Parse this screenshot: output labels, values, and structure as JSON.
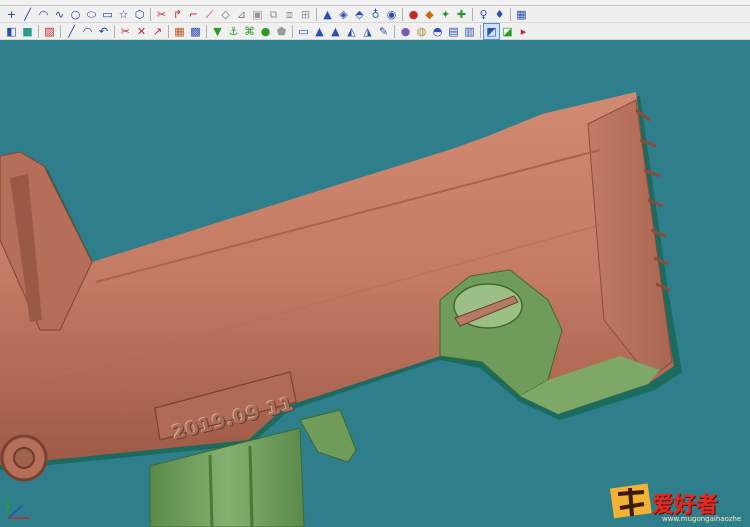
{
  "toolbar": {
    "rows": [
      {
        "row": "row1",
        "items": [
          {
            "name": "point-tool-icon",
            "glyph": "+",
            "color": "#1a3a9a"
          },
          {
            "name": "line-tool-icon",
            "glyph": "╱",
            "color": "#1a3a9a"
          },
          {
            "name": "arc-tool-icon",
            "glyph": "◠",
            "color": "#1a3a9a"
          },
          {
            "name": "spline-tool-icon",
            "glyph": "∿",
            "color": "#1a3a9a"
          },
          {
            "name": "circle-tool-icon",
            "glyph": "○",
            "color": "#1a3a9a"
          },
          {
            "name": "ellipse-tool-icon",
            "glyph": "⬭",
            "color": "#1a3a9a"
          },
          {
            "name": "rectangle-tool-icon",
            "glyph": "▭",
            "color": "#1a3a9a"
          },
          {
            "name": "star-tool-icon",
            "glyph": "☆",
            "color": "#1a3a9a"
          },
          {
            "name": "polygon-tool-icon",
            "glyph": "⬡",
            "color": "#1a3a9a"
          },
          {
            "name": "sep"
          },
          {
            "name": "trim-tool-icon",
            "glyph": "✂",
            "color": "#c0282a"
          },
          {
            "name": "fillet-tool-icon",
            "glyph": "↱",
            "color": "#c0282a"
          },
          {
            "name": "chamfer-tool-icon",
            "glyph": "⌐",
            "color": "#c0282a"
          },
          {
            "name": "extend-tool-icon",
            "glyph": "⟋",
            "color": "#c0282a"
          },
          {
            "name": "offset-curve-icon",
            "glyph": "◇",
            "color": "#777777"
          },
          {
            "name": "break-curve-icon",
            "glyph": "⊿",
            "color": "#777777"
          },
          {
            "name": "join-curve-icon",
            "glyph": "▣",
            "color": "#999999"
          },
          {
            "name": "copy-curve-icon",
            "glyph": "⧉",
            "color": "#999999"
          },
          {
            "name": "mirror-curve-icon",
            "glyph": "⧈",
            "color": "#999999"
          },
          {
            "name": "array-curve-icon",
            "glyph": "⊞",
            "color": "#999999"
          },
          {
            "name": "sep"
          },
          {
            "name": "extrude-surface-icon",
            "glyph": "▲",
            "color": "#2a4fb0"
          },
          {
            "name": "revolve-surface-icon",
            "glyph": "◈",
            "color": "#2a4fb0"
          },
          {
            "name": "sweep-surface-icon",
            "glyph": "⬘",
            "color": "#2a4fb0"
          },
          {
            "name": "loft-surface-icon",
            "glyph": "♁",
            "color": "#2a4fb0"
          },
          {
            "name": "boundary-surface-icon",
            "glyph": "◉",
            "color": "#2a4fb0"
          },
          {
            "name": "sep"
          },
          {
            "name": "sphere-solid-icon",
            "glyph": "●",
            "color": "#c0282a"
          },
          {
            "name": "cylinder-solid-icon",
            "glyph": "◆",
            "color": "#d06a10"
          },
          {
            "name": "cone-solid-icon",
            "glyph": "✦",
            "color": "#2a9a2a"
          },
          {
            "name": "torus-solid-icon",
            "glyph": "✚",
            "color": "#2a9a2a"
          },
          {
            "name": "sep"
          },
          {
            "name": "pin-tool-icon",
            "glyph": "♀",
            "color": "#2a4fb0"
          },
          {
            "name": "marker-tool-icon",
            "glyph": "♦",
            "color": "#2a4fb0"
          },
          {
            "name": "sep"
          },
          {
            "name": "layer-tool-icon",
            "glyph": "▦",
            "color": "#2a4fb0"
          }
        ]
      },
      {
        "row": "row2",
        "items": [
          {
            "name": "object-select-icon",
            "glyph": "◧",
            "color": "#2a4fb0"
          },
          {
            "name": "color-select-icon",
            "glyph": "■",
            "color": "#2a9a8a"
          },
          {
            "name": "sep"
          },
          {
            "name": "gradient-tool-icon",
            "glyph": "▨",
            "color": "#c0282a"
          },
          {
            "name": "sep"
          },
          {
            "name": "line2-tool-icon",
            "glyph": "╱",
            "color": "#1a3a9a"
          },
          {
            "name": "arc2-tool-icon",
            "glyph": "◠",
            "color": "#1a3a9a"
          },
          {
            "name": "curve2-tool-icon",
            "glyph": "↶",
            "color": "#1a3a9a"
          },
          {
            "name": "sep"
          },
          {
            "name": "cut-curve-icon",
            "glyph": "✂",
            "color": "#c0282a"
          },
          {
            "name": "split-curve-icon",
            "glyph": "✕",
            "color": "#c0282a"
          },
          {
            "name": "bend-curve-icon",
            "glyph": "↗",
            "color": "#c0282a"
          },
          {
            "name": "sep"
          },
          {
            "name": "grid-mesh-icon",
            "glyph": "▦",
            "color": "#b85a1a"
          },
          {
            "name": "patch-mesh-icon",
            "glyph": "▩",
            "color": "#2a4fb0"
          },
          {
            "name": "sep"
          },
          {
            "name": "ruled-surface-icon",
            "glyph": "▼",
            "color": "#2a9a2a"
          },
          {
            "name": "network-surface-icon",
            "glyph": "⚓",
            "color": "#2a9a2a"
          },
          {
            "name": "cap-surface-icon",
            "glyph": "⌘",
            "color": "#2a9a2a"
          },
          {
            "name": "fill-surface-icon",
            "glyph": "●",
            "color": "#2a9a2a"
          },
          {
            "name": "blend-surface-icon",
            "glyph": "⬟",
            "color": "#999999"
          },
          {
            "name": "sep"
          },
          {
            "name": "window-view-icon",
            "glyph": "▭",
            "color": "#2a4fb0"
          },
          {
            "name": "shade-view-icon",
            "glyph": "▲",
            "color": "#2a4fb0"
          },
          {
            "name": "render-view-icon",
            "glyph": "▲",
            "color": "#2a4fb0"
          },
          {
            "name": "wire-view-icon",
            "glyph": "◭",
            "color": "#2a4fb0"
          },
          {
            "name": "ghost-view-icon",
            "glyph": "◮",
            "color": "#2a4fb0"
          },
          {
            "name": "pen-view-icon",
            "glyph": "✎",
            "color": "#2a4fb0"
          },
          {
            "name": "sep"
          },
          {
            "name": "material-sphere-icon",
            "glyph": "●",
            "color": "#7a5ab0"
          },
          {
            "name": "texture-sphere-icon",
            "glyph": "◍",
            "color": "#b0902a"
          },
          {
            "name": "light-tool-icon",
            "glyph": "◓",
            "color": "#2a4fb0"
          },
          {
            "name": "camera-tool-icon",
            "glyph": "▤",
            "color": "#2a4fb0"
          },
          {
            "name": "environment-tool-icon",
            "glyph": "▥",
            "color": "#2a4fb0"
          },
          {
            "name": "sep"
          },
          {
            "name": "shaded-mode-icon",
            "glyph": "◩",
            "color": "#2a4fb0",
            "active": true
          },
          {
            "name": "render-mode-icon",
            "glyph": "◪",
            "color": "#2a9a2a"
          },
          {
            "name": "xray-mode-icon",
            "glyph": "▸",
            "color": "#c0282a"
          }
        ]
      }
    ]
  },
  "viewport": {
    "background_color": "#2e7f8b",
    "model_color": "#c77d66",
    "magazine_color": "#6f9c5a",
    "engraved_text": "2019.09 11"
  },
  "watermark": {
    "logo_text": "爱好者",
    "url_text": "www.mugongaihaozhe"
  }
}
